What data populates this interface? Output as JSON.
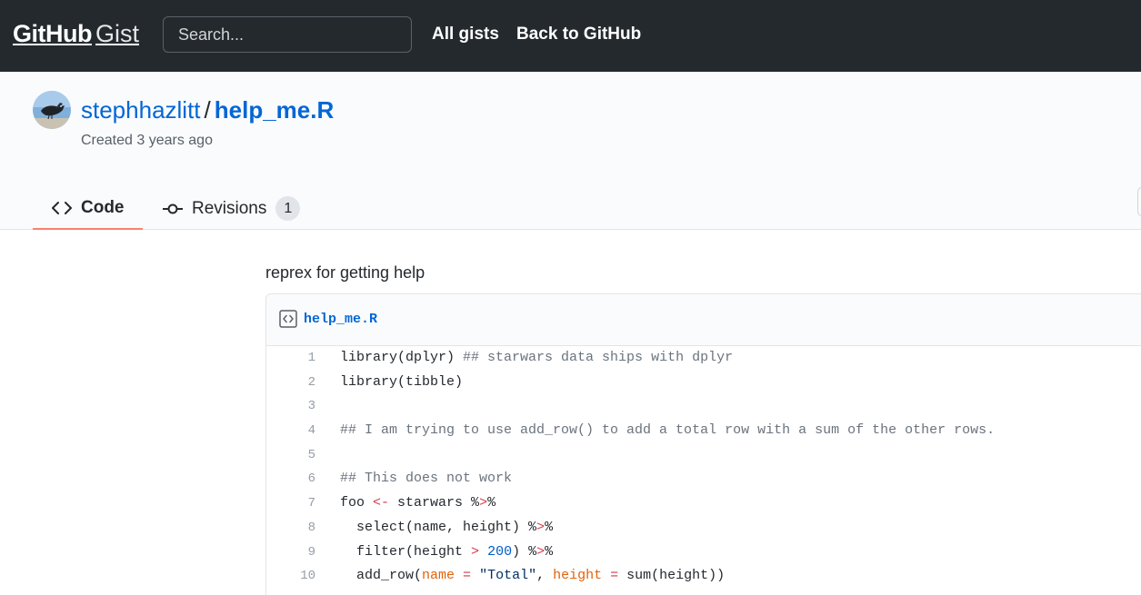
{
  "header": {
    "brand_github": "GitHub",
    "brand_gist": "Gist",
    "search_placeholder": "Search...",
    "nav": [
      "All gists",
      "Back to GitHub"
    ]
  },
  "gist": {
    "owner": "stephhazlitt",
    "separator": "/",
    "filename": "help_me.R",
    "created": "Created 3 years ago",
    "description": "reprex for getting help"
  },
  "tabs": [
    {
      "label": "Code",
      "icon": "code-icon",
      "selected": true
    },
    {
      "label": "Revisions",
      "icon": "git-commit-icon",
      "count": "1"
    }
  ],
  "file": {
    "name": "help_me.R",
    "icon": "code-file-icon",
    "lines": [
      {
        "num": "1",
        "code": "library(dplyr) ## starwars data ships with dplyr"
      },
      {
        "num": "2",
        "code": "library(tibble)"
      },
      {
        "num": "3",
        "code": ""
      },
      {
        "num": "4",
        "code": "## I am trying to use add_row() to add a total row with a sum of the other rows."
      },
      {
        "num": "5",
        "code": ""
      },
      {
        "num": "6",
        "code": "## This does not work"
      },
      {
        "num": "7",
        "code": "foo <- starwars %>%"
      },
      {
        "num": "8",
        "code": "  select(name, height) %>%"
      },
      {
        "num": "9",
        "code": "  filter(height > 200) %>%"
      },
      {
        "num": "10",
        "code": "  add_row(name = \"Total\", height = sum(height))"
      }
    ]
  },
  "colors": {
    "header_bg": "#24292e",
    "link": "#0366d6",
    "tab_underline": "#f9826c",
    "comment": "#6a737d",
    "operator": "#d73a49",
    "number": "#005cc5",
    "string": "#032f62",
    "argument": "#e36209"
  }
}
